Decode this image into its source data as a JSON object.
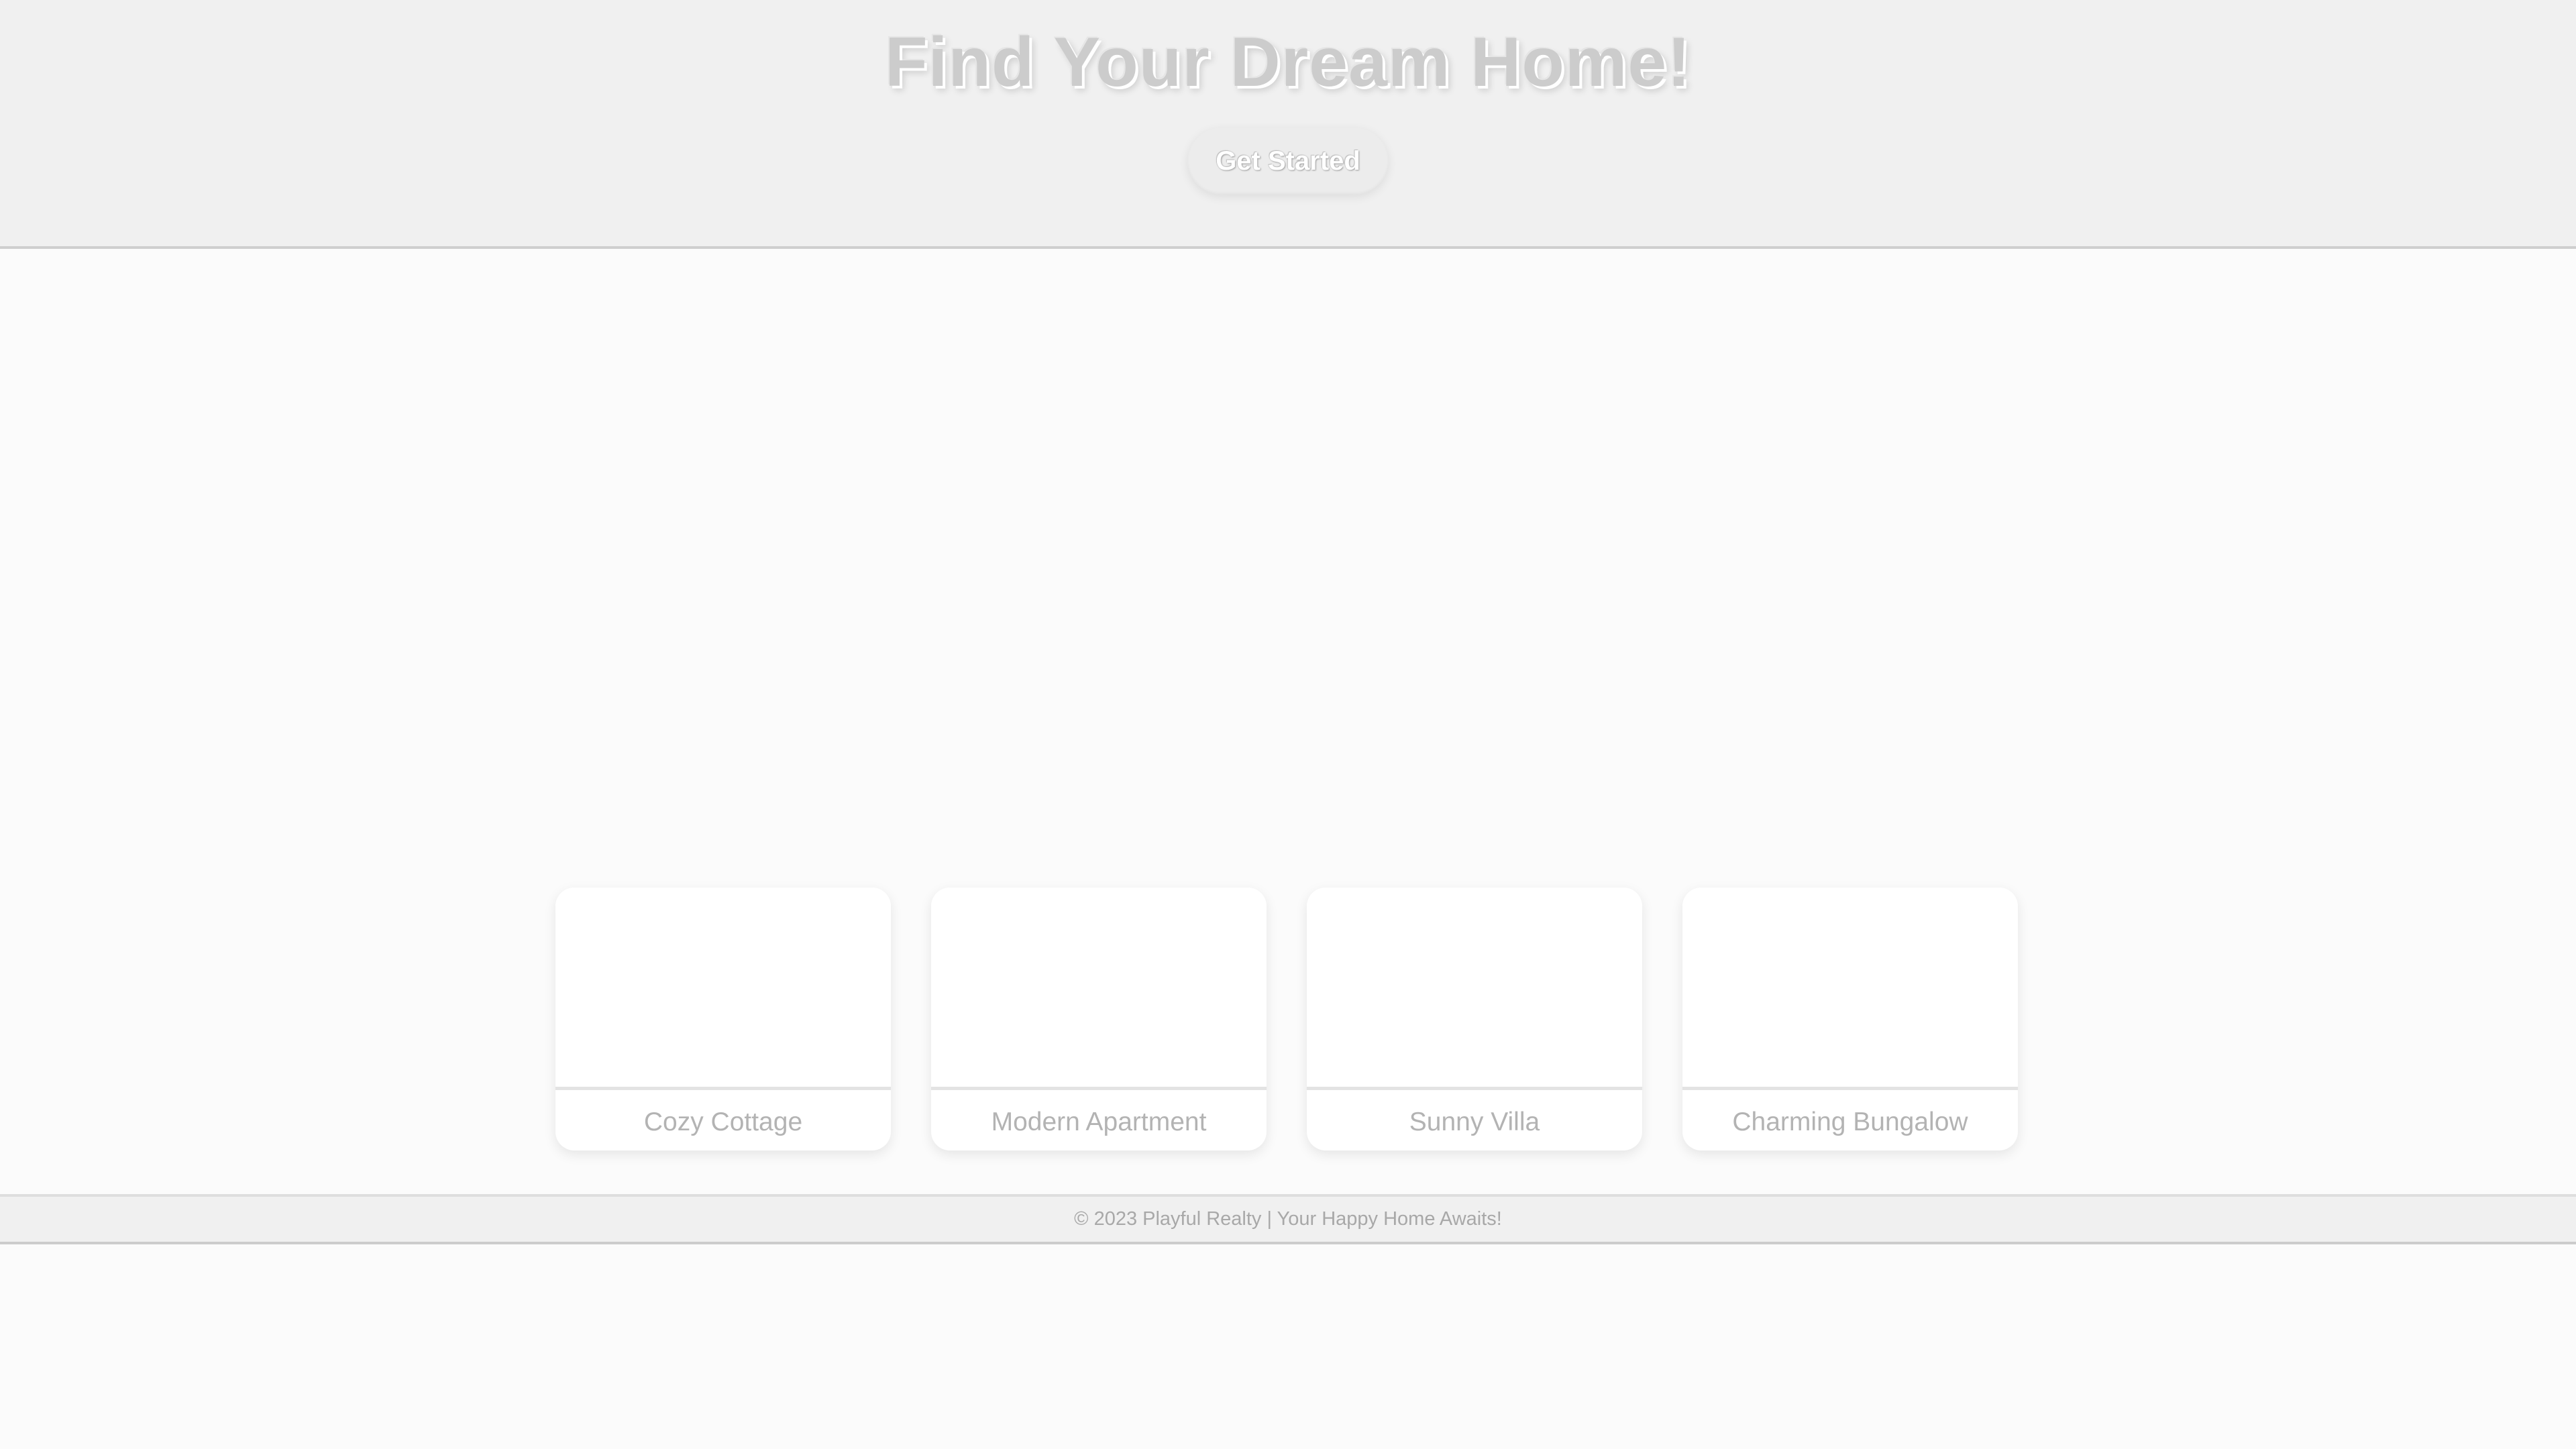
{
  "hero": {
    "title": "Find Your Dream Home!",
    "cta_label": "Get Started"
  },
  "listings": [
    {
      "name": "Cozy Cottage"
    },
    {
      "name": "Modern Apartment"
    },
    {
      "name": "Sunny Villa"
    },
    {
      "name": "Charming Bungalow"
    }
  ],
  "footer": {
    "text": "© 2023 Playful Realty | Your Happy Home Awaits!"
  },
  "colors": {
    "hero_bg": "#f0f0f0",
    "page_bg": "#fbfbfb",
    "card_bg": "#ffffff",
    "text_muted": "#b3b3b3"
  }
}
